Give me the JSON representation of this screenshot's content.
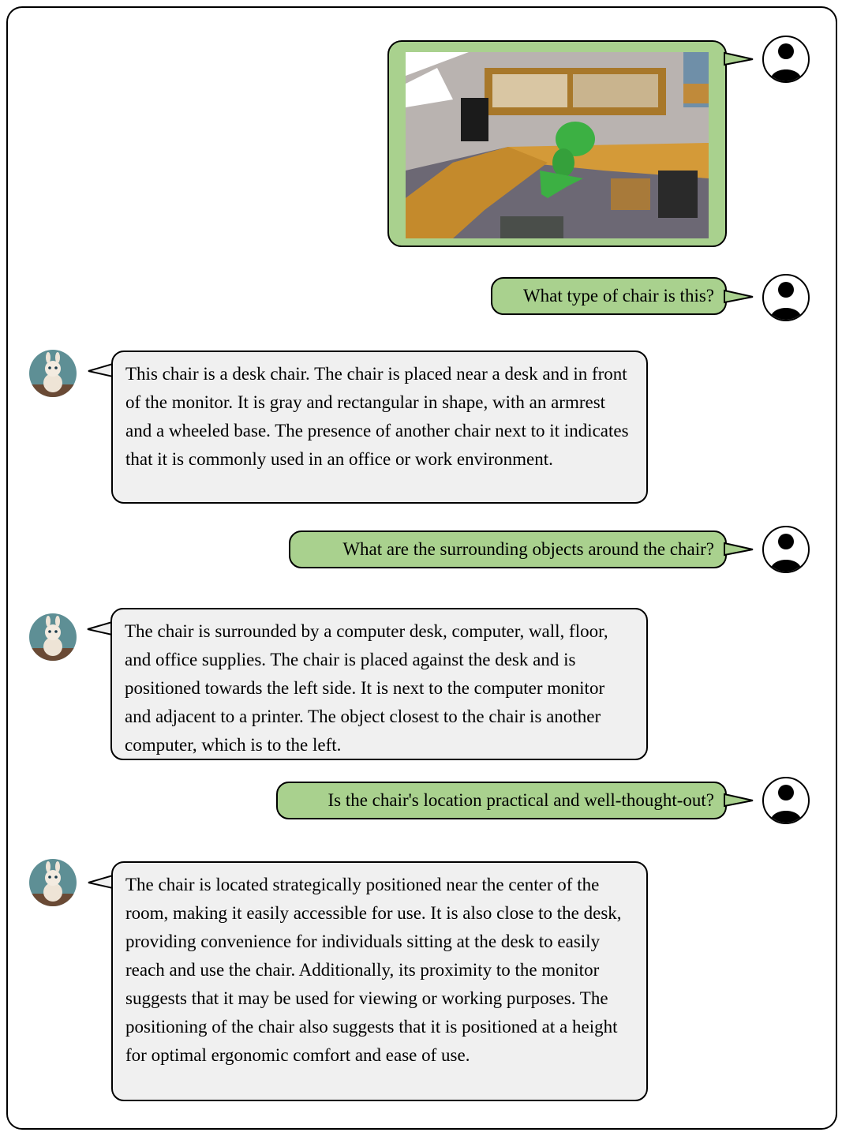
{
  "conversation": [
    {
      "role": "user",
      "type": "image",
      "image_alt": "3D scan of office room with highlighted green chair"
    },
    {
      "role": "user",
      "text": "What type of chair is this?"
    },
    {
      "role": "assistant",
      "text": "This chair is a desk chair. The chair is placed near a desk and in front of the monitor. It is gray and rectangular in shape, with an armrest and a wheeled base. The presence of another chair next to it indicates that it is commonly used in an office or work environment."
    },
    {
      "role": "user",
      "text": "What are the surrounding objects around the chair?"
    },
    {
      "role": "assistant",
      "text": "The chair is surrounded by a computer desk, computer, wall, floor, and office supplies. The chair is placed against the desk and is positioned towards the left side. It is next to the computer monitor and adjacent to a printer. The object closest to the chair is another computer, which is to the left."
    },
    {
      "role": "user",
      "text": "Is the chair's location practical and well-thought-out?"
    },
    {
      "role": "assistant",
      "text": "The chair is located strategically positioned near the center of the room, making it easily accessible for use. It is also close to the desk, providing convenience for individuals sitting at the desk to easily reach and use the chair. Additionally, its proximity to the monitor suggests that it may be used for viewing or working purposes. The positioning of the chair also suggests that it is positioned at a height for optimal ergonomic comfort and ease of use."
    }
  ],
  "colors": {
    "user_bubble": "#a9d18e",
    "assistant_bubble": "#f0f0f0",
    "highlight": "#3cb043"
  }
}
